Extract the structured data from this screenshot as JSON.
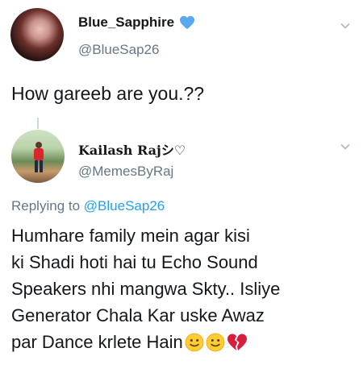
{
  "tweet1": {
    "display_name": "Blue_Sapphire",
    "verified_icon": "heart-icon",
    "verified_color": "#5aa8f0",
    "handle": "@BlueSap26",
    "text": "How gareeb are you.??"
  },
  "tweet2": {
    "display_name": "Kailash Rajシ♡",
    "handle": "@MemesByRaj",
    "replying_prefix": "Replying to",
    "replying_to": "@BlueSap26",
    "body_lines": [
      "Humhare family mein agar kisi",
      "ki Shadi hoti hai tu Echo Sound",
      "Speakers nhi mangwa Skty.. Isliye",
      "Generator Chala Kar uske Awaz",
      "par Dance krlete Hain"
    ],
    "emojis": [
      "slightly-smiling-face-icon",
      "slightly-smiling-face-icon",
      "broken-heart-icon"
    ]
  },
  "colors": {
    "text": "#14171a",
    "secondary": "#657786",
    "link": "#1da1f2"
  }
}
